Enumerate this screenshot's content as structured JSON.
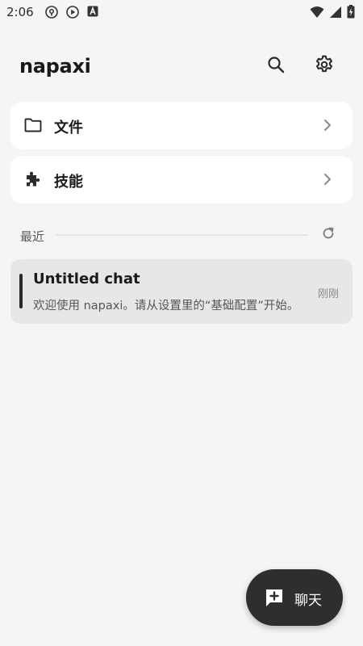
{
  "status_bar": {
    "time": "2:06",
    "left_icons": [
      "vpn-key-circle-icon",
      "play-circle-icon",
      "font-a-icon"
    ],
    "right_icons": [
      "wifi-icon",
      "cellular-signal-icon",
      "battery-charging-icon"
    ]
  },
  "header": {
    "title": "napaxi",
    "search_icon": "search-icon",
    "settings_icon": "gear-icon"
  },
  "nav_cards": [
    {
      "label": "文件",
      "icon": "folder-icon"
    },
    {
      "label": "技能",
      "icon": "puzzle-icon"
    }
  ],
  "recent": {
    "title": "最近",
    "refresh_icon": "refresh-icon"
  },
  "chats": [
    {
      "title": "Untitled chat",
      "preview": "欢迎使用 napaxi。请从设置里的“基础配置”开始。",
      "time": "刚刚"
    }
  ],
  "fab": {
    "label": "聊天",
    "icon": "add-chat-icon"
  },
  "colors": {
    "background": "#f5f5f5",
    "card": "#ffffff",
    "chat_item": "#e7e7e7",
    "fab": "#2e2e2e",
    "text_primary": "#1c1c1c",
    "text_secondary": "#555555"
  }
}
